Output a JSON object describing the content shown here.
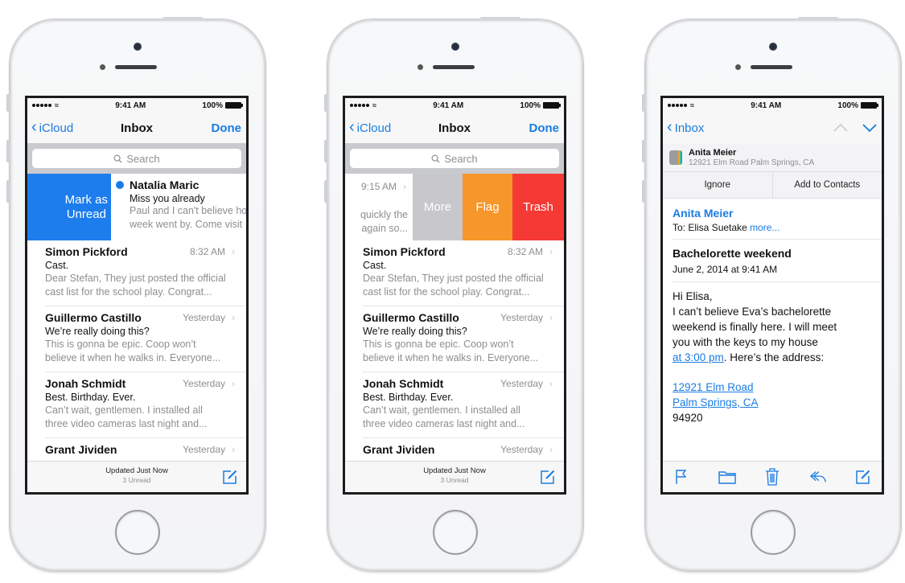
{
  "status_bar": {
    "time": "9:41 AM",
    "battery": "100%",
    "signal_bars": 5
  },
  "phones": [
    {
      "view": "inbox-swipe-right",
      "nav": {
        "back_label": "iCloud",
        "title": "Inbox",
        "done_label": "Done"
      },
      "search_placeholder": "Search",
      "swipe_row": {
        "action_label_line1": "Mark as",
        "action_label_line2": "Unread",
        "action_color": "#1d7ded",
        "from": "Natalia Maric",
        "subject": "Miss you already",
        "preview_line1": "Paul and I can't believe how",
        "preview_line2": "week went by. Come visit"
      },
      "footer": {
        "status": "Updated Just Now",
        "unread": "3 Unread"
      }
    },
    {
      "view": "inbox-swipe-left",
      "nav": {
        "back_label": "iCloud",
        "title": "Inbox",
        "done_label": "Done"
      },
      "search_placeholder": "Search",
      "swipe_row": {
        "time": "9:15 AM",
        "preview_line1": "quickly the",
        "preview_line2": "again so...",
        "actions": [
          {
            "label": "More",
            "color": "#c7c7cc"
          },
          {
            "label": "Flag",
            "color": "#f7962a"
          },
          {
            "label": "Trash",
            "color": "#f53a36"
          }
        ]
      },
      "footer": {
        "status": "Updated Just Now",
        "unread": "3 Unread"
      }
    },
    {
      "view": "message-detail",
      "nav": {
        "back_label": "Inbox",
        "prev_icon": "chevron-up-icon",
        "next_icon": "chevron-down-icon"
      },
      "contact_banner": {
        "name": "Anita Meier",
        "address": "12921 Elm Road Palm Springs, CA",
        "ignore_label": "Ignore",
        "add_label": "Add to Contacts"
      },
      "message": {
        "from": "Anita Meier",
        "to_prefix": "To: Elisa Suetake",
        "more_label": "more...",
        "subject": "Bachelorette weekend",
        "date": "June 2, 2014 at 9:41 AM",
        "greeting": "Hi Elisa,",
        "body_line1": "I can’t believe Eva’s bachelorette",
        "body_line2": "weekend is finally here. I will meet",
        "body_line3": "you with the keys to my house",
        "time_link": "at 3:00 pm",
        "body_after_link": ". Here’s the address:",
        "address_line1": "12921 Elm Road",
        "address_line2": "Palm Springs, CA",
        "zip": "94920"
      },
      "toolbar": [
        "flag-icon",
        "folder-icon",
        "trash-icon",
        "reply-icon",
        "compose-icon"
      ]
    }
  ],
  "mail_list": [
    {
      "from": "Simon Pickford",
      "time": "8:32 AM",
      "subject": "Cast.",
      "preview_line1": "Dear Stefan, They just posted the official",
      "preview_line2": "cast list for the school play. Congrat..."
    },
    {
      "from": "Guillermo Castillo",
      "time": "Yesterday",
      "subject": "We’re really doing this?",
      "preview_line1": "This is gonna be epic. Coop won’t",
      "preview_line2": "believe it when he walks in. Everyone..."
    },
    {
      "from": "Jonah Schmidt",
      "time": "Yesterday",
      "subject": "Best. Birthday. Ever.",
      "preview_line1": "Can’t wait, gentlemen. I installed all",
      "preview_line2": "three video cameras last night and..."
    },
    {
      "from": "Grant Jividen",
      "time": "Yesterday"
    }
  ],
  "colors": {
    "accent": "#1a7ce3",
    "unread_dot": "#1a7ce3"
  }
}
